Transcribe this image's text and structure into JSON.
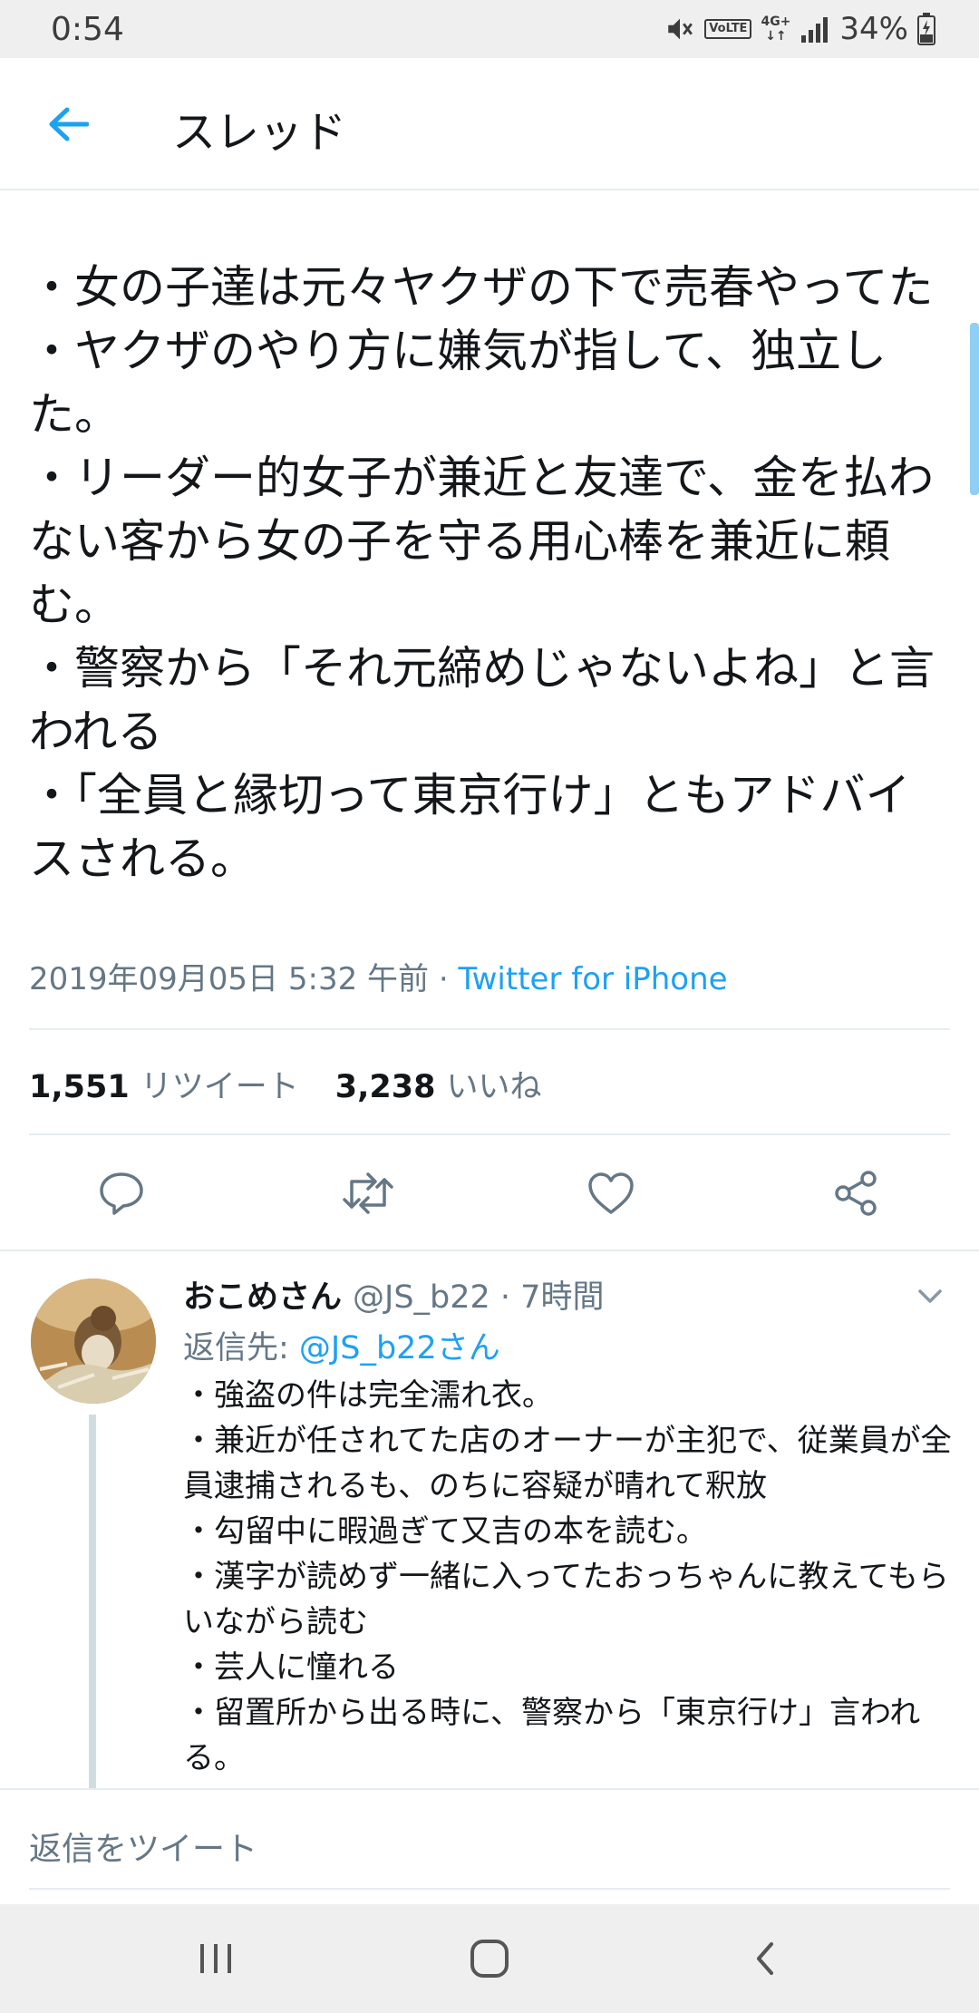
{
  "status_bar": {
    "time": "0:54",
    "volte": "VoLTE",
    "network": "4G+",
    "battery": "34%"
  },
  "app_bar": {
    "title": "スレッド",
    "back_icon": "arrow-left-icon",
    "accent_color": "#1da1f2"
  },
  "tweet": {
    "text": "・女の子達は元々ヤクザの下で売春やってた\n・ヤクザのやり方に嫌気が指して、独立した。\n・リーダー的女子が兼近と友達で、金を払わない客から女の子を守る用心棒を兼近に頼む。\n・警察から「それ元締めじゃないよね」と言われる\n・「全員と縁切って東京行け」ともアドバイスされる。",
    "timestamp": "2019年09月05日 5:32 午前",
    "separator": " · ",
    "source": "Twitter for iPhone",
    "retweets_count": "1,551",
    "retweets_label": "リツイート",
    "likes_count": "3,238",
    "likes_label": "いいね"
  },
  "actions": [
    "reply-icon",
    "retweet-icon",
    "like-icon",
    "share-icon"
  ],
  "reply": {
    "name": "おこめさん",
    "handle": "@JS_b22 · 7時間",
    "reply_to_label": "返信先: ",
    "reply_to_mention": "@JS_b22さん",
    "text": "・強盗の件は完全濡れ衣。\n・兼近が任されてた店のオーナーが主犯で、従業員が全員逮捕されるも、のちに容疑が晴れて釈放\n・勾留中に暇過ぎて又吉の本を読む。\n・漢字が読めず一緒に入ってたおっちゃんに教えてもらいながら読む\n・芸人に憧れる\n・留置所から出る時に、警察から「東京行け」言われる。"
  },
  "compose": {
    "placeholder": "返信をツイート"
  }
}
